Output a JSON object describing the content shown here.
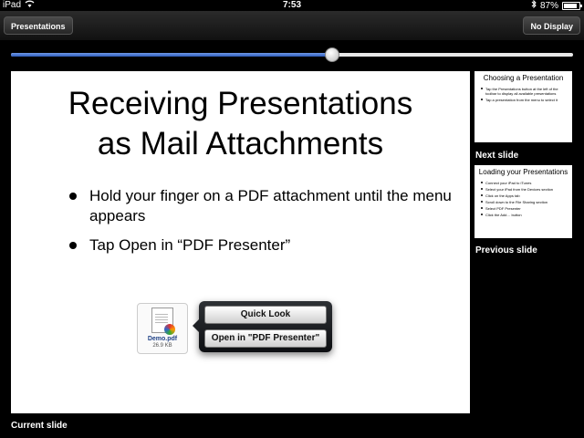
{
  "status_bar": {
    "device": "iPad",
    "time": "7:53",
    "battery": "87%",
    "battery_level": 0.87,
    "icons": [
      "wifi-icon",
      "bluetooth-icon",
      "battery-icon"
    ]
  },
  "toolbar": {
    "presentations_label": "Presentations",
    "display_label": "No Display"
  },
  "slider": {
    "progress": 0.57
  },
  "current_slide": {
    "title_line1": "Receiving Presentations",
    "title_line2": "as Mail Attachments",
    "bullets": [
      "Hold your finger on a PDF attachment until the menu appears",
      "Tap Open in “PDF Presenter”"
    ],
    "attachment": {
      "name": "Demo.pdf",
      "size": "26.9 KB"
    },
    "menu": {
      "quick_look": "Quick Look",
      "open_in": "Open in \"PDF Presenter\""
    }
  },
  "next_slide": {
    "title": "Choosing a Presentation",
    "bullets": [
      "Tap the Presentations button at the left of the toolbar to display all available presentations",
      "Tap a presentation from the menu to select it"
    ]
  },
  "previous_slide": {
    "title": "Loading your Presentations",
    "bullets": [
      "Connect your iPad to iTunes",
      "Select your iPad from the Devices section",
      "Click on the Apps tab",
      "Scroll down to the File Sharing section",
      "Select PDF Presenter",
      "Click the Add… button"
    ]
  },
  "labels": {
    "next": "Next slide",
    "previous": "Previous slide",
    "current": "Current slide"
  },
  "colors": {
    "accent_blue": "#3b6fd0",
    "background": "#000000"
  }
}
